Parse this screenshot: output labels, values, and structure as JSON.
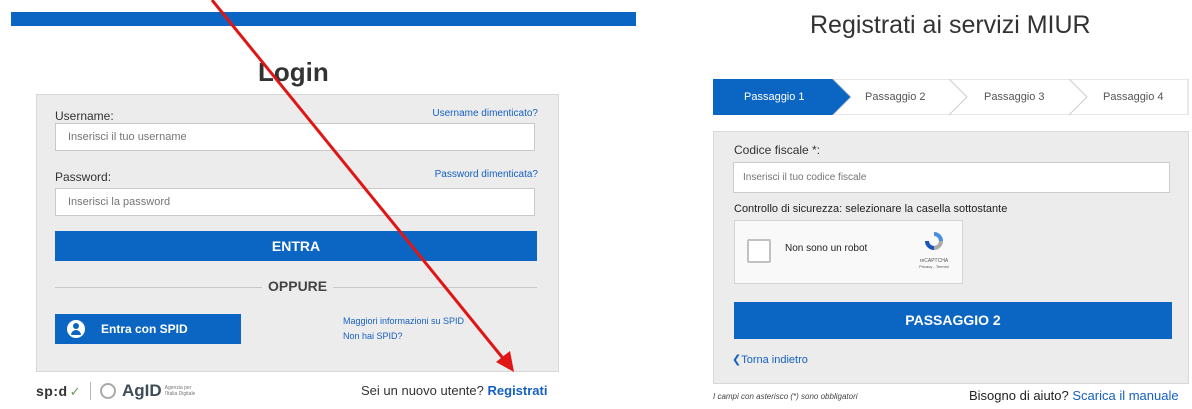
{
  "login": {
    "title": "Login",
    "username_label": "Username:",
    "username_forgot": "Username dimenticato?",
    "username_placeholder": "Inserisci il tuo username",
    "password_label": "Password:",
    "password_forgot": "Password dimenticata?",
    "password_placeholder": "Inserisci la password",
    "enter_button": "ENTRA",
    "or_label": "OPPURE",
    "spid_button": "Entra con SPID",
    "spid_info_link": "Maggiori informazioni su SPID",
    "spid_none_link": "Non hai SPID?",
    "new_user_text": "Sei un nuovo utente?",
    "register_link": "Registrati",
    "footer_spid_logo": "sp:d",
    "footer_agid_logo": "AgID",
    "footer_agid_sub": "Agenzia per l'Italia Digitale"
  },
  "register": {
    "title": "Registrati ai servizi MIUR",
    "steps": [
      "Passaggio 1",
      "Passaggio 2",
      "Passaggio 3",
      "Passaggio 4"
    ],
    "active_step": 1,
    "cf_label": "Codice fiscale *:",
    "cf_placeholder": "Inserisci il tuo codice fiscale",
    "security_label": "Controllo di sicurezza: selezionare la casella sottostante",
    "captcha_text": "Non sono un robot",
    "captcha_brand": "reCAPTCHA",
    "captcha_terms": "Privacy - Termini",
    "next_button": "PASSAGGIO 2",
    "back_link": "Torna indietro",
    "required_note": "I campi con asterisco (*) sono obbligatori",
    "help_text": "Bisogno di aiuto?",
    "manual_link": "Scarica il manuale"
  },
  "colors": {
    "primary": "#0b66c3",
    "link": "#1560c0",
    "annotation_arrow": "#e01515"
  }
}
